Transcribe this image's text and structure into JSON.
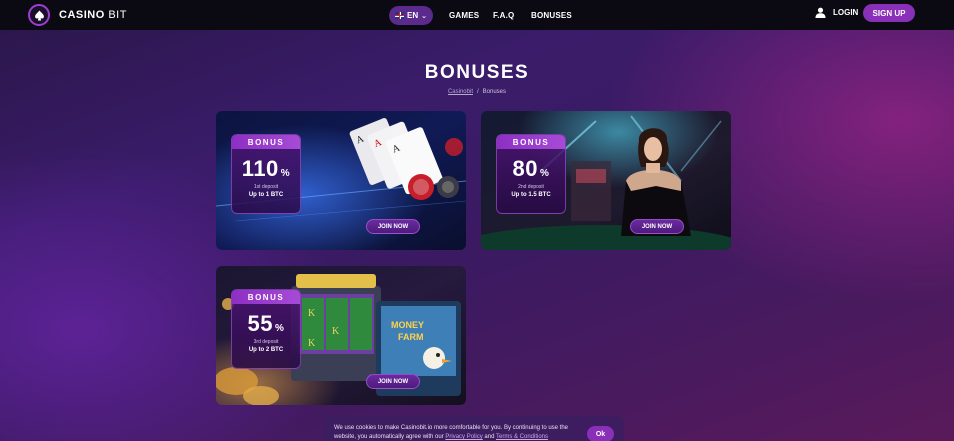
{
  "header": {
    "logo_main": "CASINO",
    "logo_sub": "BIT",
    "language": "EN",
    "nav": [
      "GAMES",
      "F.A.Q",
      "BONUSES"
    ],
    "login_label": "LOGIN",
    "signup_label": "SIGN UP"
  },
  "page": {
    "title": "BONUSES",
    "breadcrumb": [
      "Casinobit",
      "/",
      "Bonuses"
    ]
  },
  "cards": [
    {
      "badge": "BONUS",
      "percent": "110",
      "percent_sign": "%",
      "deposit": "1st deposit",
      "max": "Up to 1 BTC",
      "button": "JOIN NOW"
    },
    {
      "badge": "BONUS",
      "percent": "80",
      "percent_sign": "%",
      "deposit": "2nd deposit",
      "max": "Up to 1.5 BTC",
      "button": "JOIN NOW"
    },
    {
      "badge": "BONUS",
      "percent": "55",
      "percent_sign": "%",
      "deposit": "3rd deposit",
      "max": "Up to 2 BTC",
      "button": "JOIN NOW"
    }
  ],
  "cookie": {
    "text_1": "We use cookies to make Casinobit.io more comfortable for you. By continuing to use the website, you automatically agree with our ",
    "link_privacy": "Privacy Policy",
    "text_2": " and ",
    "link_terms": "Terms & Conditions",
    "ok_label": "Ok"
  },
  "colors": {
    "accent": "#8a2fb8",
    "header_bg": "#0b0912",
    "lang_pill": "#5a2a8c"
  },
  "icons": {
    "logo": "spade-icon",
    "user": "user-icon",
    "language": "uk-flag-icon",
    "dropdown": "chevron-down-icon"
  }
}
